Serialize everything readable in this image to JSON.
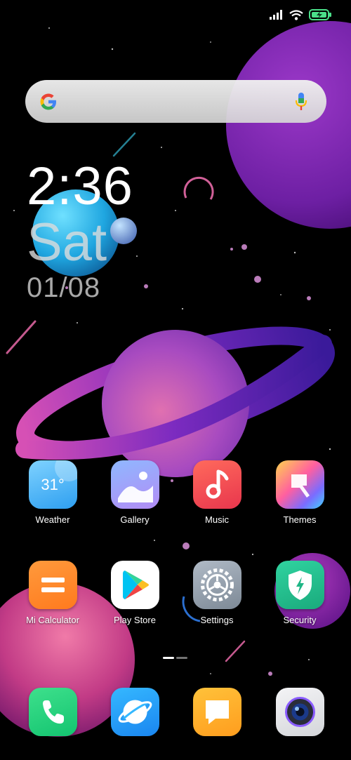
{
  "status_bar": {
    "icons": [
      "signal-bars-icon",
      "wifi-icon",
      "battery-charging-icon"
    ]
  },
  "search": {
    "logo": "google-g-logo",
    "mic_icon": "microphone-icon"
  },
  "clock": {
    "time": "2:36",
    "day": "Sat",
    "date": "01/08"
  },
  "home_grid": [
    {
      "label": "Weather",
      "icon": "weather-icon",
      "badge": "31°"
    },
    {
      "label": "Gallery",
      "icon": "gallery-icon"
    },
    {
      "label": "Music",
      "icon": "music-icon"
    },
    {
      "label": "Themes",
      "icon": "themes-icon"
    },
    {
      "label": "Mi Calculator",
      "icon": "calculator-icon"
    },
    {
      "label": "Play Store",
      "icon": "play-store-icon"
    },
    {
      "label": "Settings",
      "icon": "settings-icon"
    },
    {
      "label": "Security",
      "icon": "security-icon"
    }
  ],
  "dock": [
    {
      "icon": "phone-icon"
    },
    {
      "icon": "browser-icon"
    },
    {
      "icon": "messages-icon"
    },
    {
      "icon": "camera-icon"
    }
  ],
  "page_indicator": {
    "pages": 2,
    "current": 1
  },
  "colors": {
    "accent_purple": "#7b2fb8",
    "planet_pink": "#e05aa8",
    "search_bg": "#e8e8e8"
  }
}
